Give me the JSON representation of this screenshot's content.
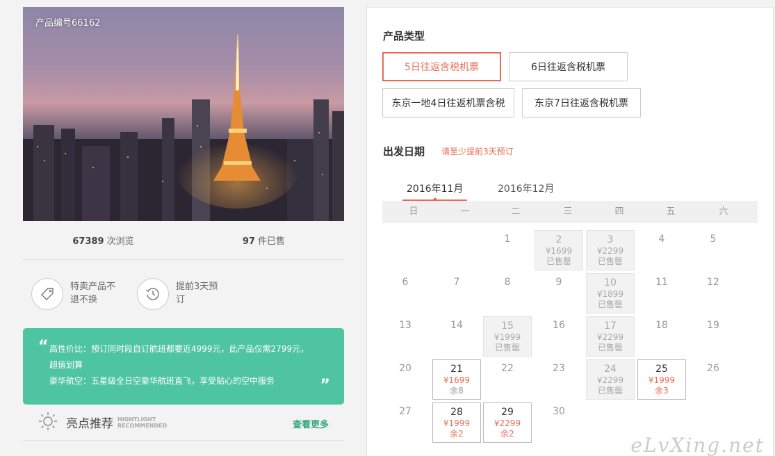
{
  "product": {
    "code_label": "产品编号66162",
    "views_num": "67389",
    "views_unit": "次浏览",
    "sold_num": "97",
    "sold_unit": "件已售"
  },
  "features": [
    {
      "icon": "tag-icon",
      "text": "特卖产品不退不换"
    },
    {
      "icon": "clock-icon",
      "text": "提前3天预订"
    }
  ],
  "quote": {
    "line1": "高性价比：预订同时段自订航班都要近4999元，此产品仅需2799元，超值划算",
    "line2": "豪华航空：五星级全日空豪华航班直飞，享受贴心的空中服务"
  },
  "highlight": {
    "title": "亮点推荐",
    "en1": "HIGHTLIGHT",
    "en2": "RECOMMENDED",
    "more": "查看更多"
  },
  "product_type": {
    "title": "产品类型",
    "options": [
      {
        "label": "5日往返含税机票",
        "active": true
      },
      {
        "label": "6日往返含税机票",
        "active": false
      },
      {
        "label": "东京一地4日往返机票含税",
        "active": false
      },
      {
        "label": "东京7日往返含税机票",
        "active": false
      }
    ]
  },
  "departure": {
    "title": "出发日期",
    "note": "请至少提前3天预订",
    "months": [
      {
        "label": "2016年11月",
        "active": true
      },
      {
        "label": "2016年12月",
        "active": false
      }
    ],
    "weekdays": [
      "日",
      "一",
      "二",
      "三",
      "四",
      "五",
      "六"
    ],
    "days": [
      {
        "d": "1",
        "col": 2,
        "row": 0
      },
      {
        "d": "2",
        "col": 3,
        "row": 0,
        "state": "sold",
        "price": "¥1699",
        "rest": "已售罄"
      },
      {
        "d": "3",
        "col": 4,
        "row": 0,
        "state": "sold",
        "price": "¥2299",
        "rest": "已售罄"
      },
      {
        "d": "4",
        "col": 5,
        "row": 0
      },
      {
        "d": "5",
        "col": 6,
        "row": 0
      },
      {
        "d": "6",
        "col": 0,
        "row": 1
      },
      {
        "d": "7",
        "col": 1,
        "row": 1
      },
      {
        "d": "8",
        "col": 2,
        "row": 1
      },
      {
        "d": "9",
        "col": 3,
        "row": 1
      },
      {
        "d": "10",
        "col": 4,
        "row": 1,
        "state": "sold",
        "price": "¥1899",
        "rest": "已售罄"
      },
      {
        "d": "11",
        "col": 5,
        "row": 1
      },
      {
        "d": "12",
        "col": 6,
        "row": 1
      },
      {
        "d": "13",
        "col": 0,
        "row": 2
      },
      {
        "d": "14",
        "col": 1,
        "row": 2
      },
      {
        "d": "15",
        "col": 2,
        "row": 2,
        "state": "sold",
        "price": "¥1999",
        "rest": "已售罄"
      },
      {
        "d": "16",
        "col": 3,
        "row": 2
      },
      {
        "d": "17",
        "col": 4,
        "row": 2,
        "state": "sold",
        "price": "¥2299",
        "rest": "已售罄"
      },
      {
        "d": "18",
        "col": 5,
        "row": 2
      },
      {
        "d": "19",
        "col": 6,
        "row": 2
      },
      {
        "d": "20",
        "col": 0,
        "row": 3
      },
      {
        "d": "21",
        "col": 1,
        "row": 3,
        "state": "avail",
        "price": "¥1699",
        "rest": "余8",
        "rest_gray": true
      },
      {
        "d": "22",
        "col": 2,
        "row": 3
      },
      {
        "d": "23",
        "col": 3,
        "row": 3
      },
      {
        "d": "24",
        "col": 4,
        "row": 3,
        "state": "sold",
        "price": "¥2299",
        "rest": "已售罄"
      },
      {
        "d": "25",
        "col": 5,
        "row": 3,
        "state": "avail",
        "price": "¥1999",
        "rest": "余3"
      },
      {
        "d": "26",
        "col": 6,
        "row": 3
      },
      {
        "d": "27",
        "col": 0,
        "row": 4
      },
      {
        "d": "28",
        "col": 1,
        "row": 4,
        "state": "avail",
        "price": "¥1999",
        "rest": "余2"
      },
      {
        "d": "29",
        "col": 2,
        "row": 4,
        "state": "avail",
        "price": "¥2299",
        "rest": "余2"
      },
      {
        "d": "30",
        "col": 3,
        "row": 4
      }
    ]
  },
  "watermark": "eLvXing.net",
  "colors": {
    "accent": "#e86c55",
    "teal": "#4fc4a3",
    "link": "#2fa47d"
  }
}
